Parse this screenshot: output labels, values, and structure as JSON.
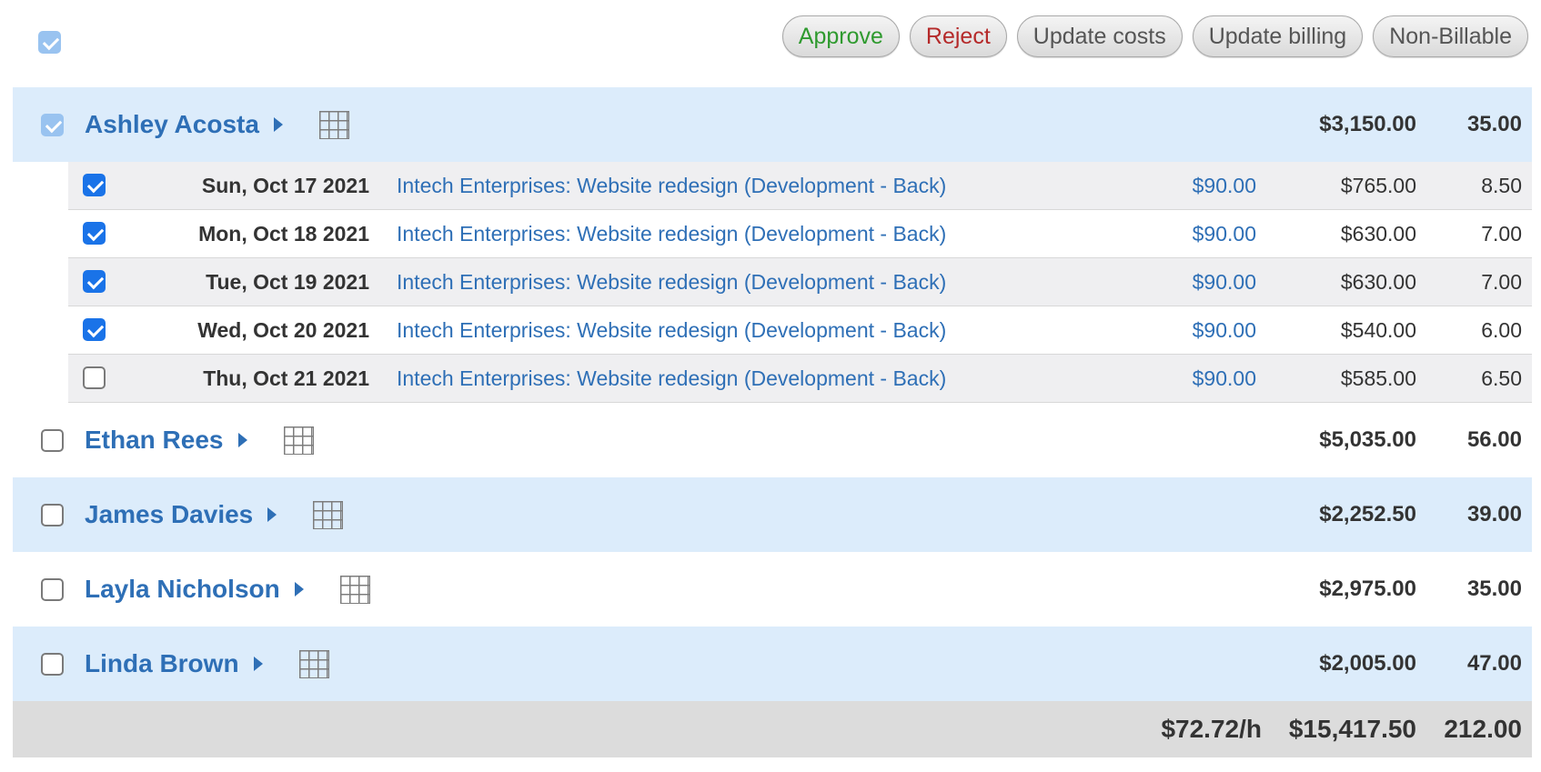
{
  "toolbar": {
    "select_all_checked": true,
    "buttons": {
      "approve": "Approve",
      "reject": "Reject",
      "update_costs": "Update costs",
      "update_billing": "Update billing",
      "non_billable": "Non-Billable"
    }
  },
  "colors": {
    "link_blue": "#2e6fb6",
    "row_blue": "#dcecfb",
    "approve_green": "#2f9a2f",
    "reject_red": "#b52a2a",
    "totals_gray": "#dcdcdc"
  },
  "groups": [
    {
      "name": "Ashley Acosta",
      "amount": "$3,150.00",
      "hours": "35.00",
      "checked": true,
      "expanded": true,
      "entries": [
        {
          "date": "Sun, Oct 17 2021",
          "project": "Intech Enterprises: Website redesign (Development - Back)",
          "rate": "$90.00",
          "amount": "$765.00",
          "hours": "8.50",
          "checked": true
        },
        {
          "date": "Mon, Oct 18 2021",
          "project": "Intech Enterprises: Website redesign (Development - Back)",
          "rate": "$90.00",
          "amount": "$630.00",
          "hours": "7.00",
          "checked": true
        },
        {
          "date": "Tue, Oct 19 2021",
          "project": "Intech Enterprises: Website redesign (Development - Back)",
          "rate": "$90.00",
          "amount": "$630.00",
          "hours": "7.00",
          "checked": true
        },
        {
          "date": "Wed, Oct 20 2021",
          "project": "Intech Enterprises: Website redesign (Development - Back)",
          "rate": "$90.00",
          "amount": "$540.00",
          "hours": "6.00",
          "checked": true
        },
        {
          "date": "Thu, Oct 21 2021",
          "project": "Intech Enterprises: Website redesign (Development - Back)",
          "rate": "$90.00",
          "amount": "$585.00",
          "hours": "6.50",
          "checked": false
        }
      ]
    },
    {
      "name": "Ethan Rees",
      "amount": "$5,035.00",
      "hours": "56.00",
      "checked": false
    },
    {
      "name": "James Davies",
      "amount": "$2,252.50",
      "hours": "39.00",
      "checked": false
    },
    {
      "name": "Layla Nicholson",
      "amount": "$2,975.00",
      "hours": "35.00",
      "checked": false
    },
    {
      "name": "Linda Brown",
      "amount": "$2,005.00",
      "hours": "47.00",
      "checked": false
    }
  ],
  "totals": {
    "rate": "$72.72/h",
    "amount": "$15,417.50",
    "hours": "212.00"
  }
}
